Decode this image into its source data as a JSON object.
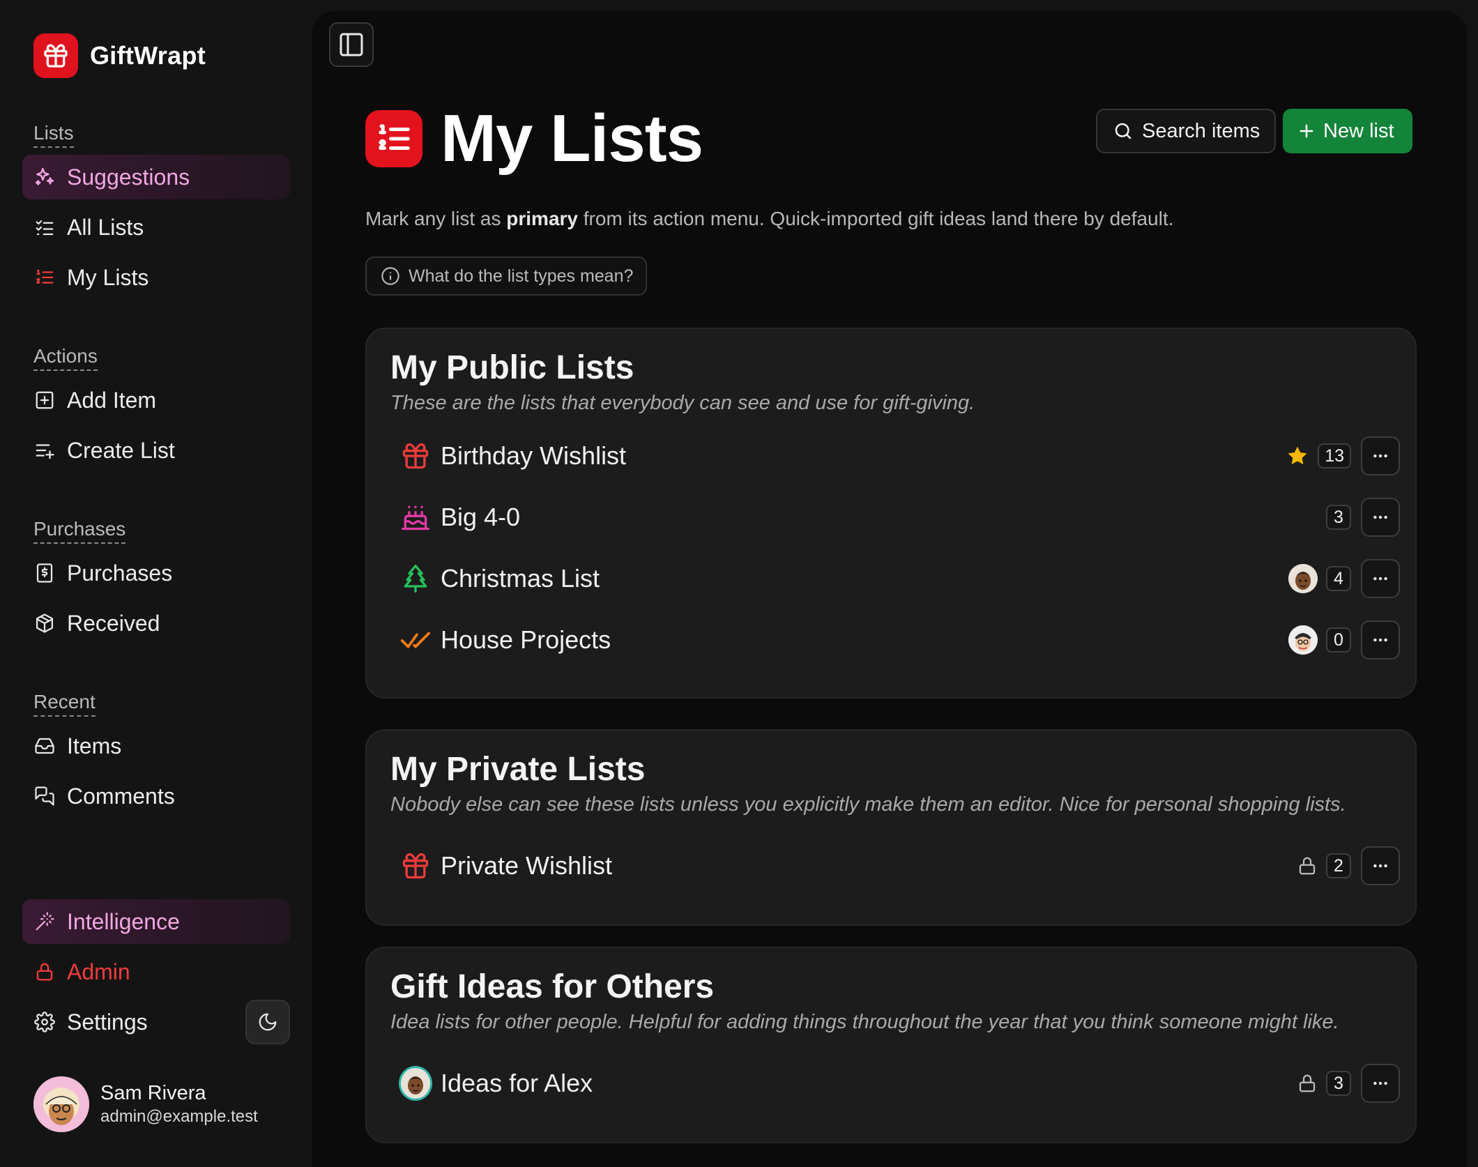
{
  "app": {
    "name": "GiftWrapt",
    "brand_color": "#e0121d"
  },
  "sidebar": {
    "sections": {
      "lists": "Lists",
      "actions": "Actions",
      "purchases": "Purchases",
      "recent": "Recent"
    },
    "items": {
      "suggestions": "Suggestions",
      "all_lists": "All Lists",
      "my_lists": "My Lists",
      "add_item": "Add Item",
      "create_list": "Create List",
      "purchases": "Purchases",
      "received": "Received",
      "items": "Items",
      "comments": "Comments",
      "intelligence": "Intelligence",
      "admin": "Admin",
      "settings": "Settings"
    },
    "user": {
      "name": "Sam Rivera",
      "email": "admin@example.test"
    }
  },
  "header": {
    "title": "My Lists",
    "search_label": "Search items",
    "new_list_label": "New list",
    "hint_pre": "Mark any list as ",
    "hint_bold": "primary",
    "hint_post": " from its action menu. Quick-imported gift ideas land there by default.",
    "types_button": "What do the list types mean?"
  },
  "cards": {
    "public": {
      "title": "My Public Lists",
      "subtitle": "These are the lists that everybody can see and use for gift-giving.",
      "rows": [
        {
          "label": "Birthday Wishlist",
          "count": "13",
          "icon": "gift-icon",
          "badge": "star-icon"
        },
        {
          "label": "Big 4-0",
          "count": "3",
          "icon": "cake-icon",
          "badge": ""
        },
        {
          "label": "Christmas List",
          "count": "4",
          "icon": "tree-icon",
          "badge": "avatar"
        },
        {
          "label": "House Projects",
          "count": "0",
          "icon": "double-check-icon",
          "badge": "avatar"
        }
      ]
    },
    "private": {
      "title": "My Private Lists",
      "subtitle": "Nobody else can see these lists unless you explicitly make them an editor. Nice for personal shopping lists.",
      "rows": [
        {
          "label": "Private Wishlist",
          "count": "2",
          "icon": "gift-icon",
          "badge": "lock-icon"
        }
      ]
    },
    "ideas": {
      "title": "Gift Ideas for Others",
      "subtitle": "Idea lists for other people. Helpful for adding things throughout the year that you think someone might like.",
      "rows": [
        {
          "label": "Ideas for Alex",
          "count": "3",
          "icon": "avatar",
          "badge": "lock-icon"
        }
      ]
    }
  },
  "colors": {
    "accent_pink": "#f0a8e2",
    "primary_green": "#13843a",
    "admin_red": "#ef3b3b",
    "star": "#f5b700",
    "tree": "#27c05a",
    "check": "#f07a1a",
    "cake": "#e23aa6"
  }
}
